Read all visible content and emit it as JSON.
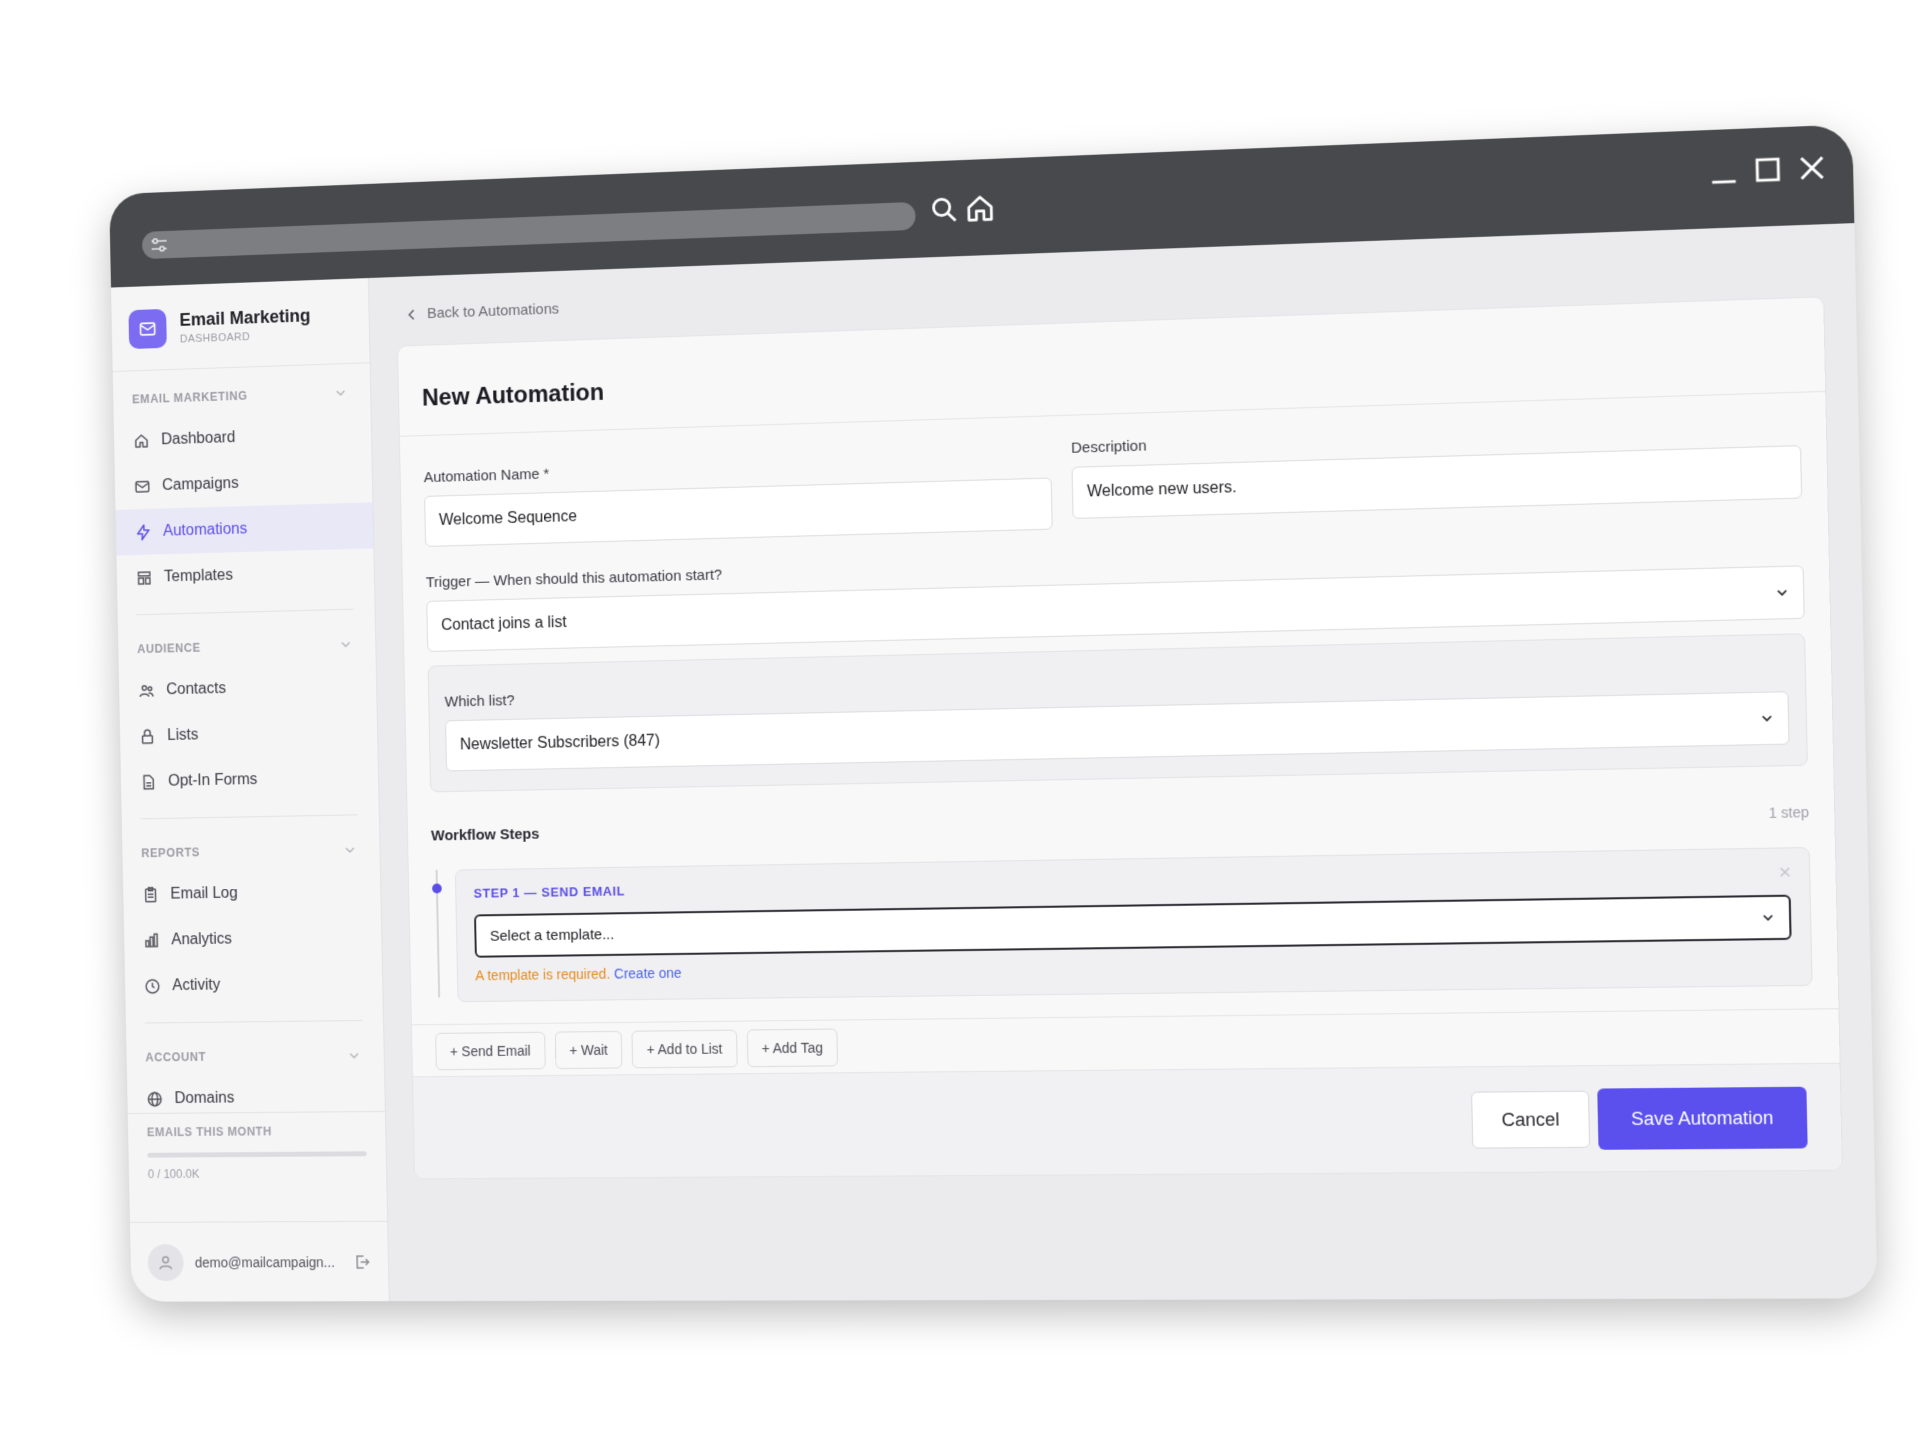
{
  "brand": {
    "title": "Email Marketing",
    "subtitle": "DASHBOARD"
  },
  "sidebar": {
    "sections": [
      {
        "title": "EMAIL MARKETING",
        "items": [
          {
            "label": "Dashboard",
            "icon": "home-icon"
          },
          {
            "label": "Campaigns",
            "icon": "mail-icon"
          },
          {
            "label": "Automations",
            "icon": "bolt-icon",
            "active": true
          },
          {
            "label": "Templates",
            "icon": "template-icon"
          }
        ]
      },
      {
        "title": "AUDIENCE",
        "items": [
          {
            "label": "Contacts",
            "icon": "contacts-icon"
          },
          {
            "label": "Lists",
            "icon": "lock-icon"
          },
          {
            "label": "Opt-In Forms",
            "icon": "document-icon"
          }
        ]
      },
      {
        "title": "REPORTS",
        "items": [
          {
            "label": "Email Log",
            "icon": "clipboard-icon"
          },
          {
            "label": "Analytics",
            "icon": "bar-chart-icon"
          },
          {
            "label": "Activity",
            "icon": "clock-icon"
          }
        ]
      },
      {
        "title": "ACCOUNT",
        "items": [
          {
            "label": "Domains",
            "icon": "globe-icon"
          }
        ]
      }
    ],
    "usage": {
      "label": "EMAILS THIS MONTH",
      "count": "0 / 100.0K",
      "used_fraction": 0
    },
    "user": {
      "email": "demo@mailcampaign..."
    }
  },
  "main": {
    "back_label": "Back to Automations",
    "title": "New Automation",
    "form": {
      "name_label": "Automation Name *",
      "name_value": "Welcome Sequence",
      "description_label": "Description",
      "description_value": "Welcome new users.",
      "trigger_label": "Trigger — When should this automation start?",
      "trigger_value": "Contact joins a list",
      "list_label": "Which list?",
      "list_value": "Newsletter Subscribers (847)"
    },
    "workflow": {
      "title": "Workflow Steps",
      "count": "1 step",
      "steps": [
        {
          "label": "STEP 1 — SEND EMAIL",
          "select_placeholder": "Select a template...",
          "error": "A template is required.",
          "error_link": "Create one"
        }
      ],
      "add_buttons": [
        "+ Send Email",
        "+ Wait",
        "+ Add to List",
        "+ Add Tag"
      ]
    },
    "footer": {
      "cancel_label": "Cancel",
      "save_label": "Save Automation"
    }
  },
  "colors": {
    "accent": "#5b50ee",
    "warning": "#e58a1e",
    "link": "#4b63e6"
  }
}
